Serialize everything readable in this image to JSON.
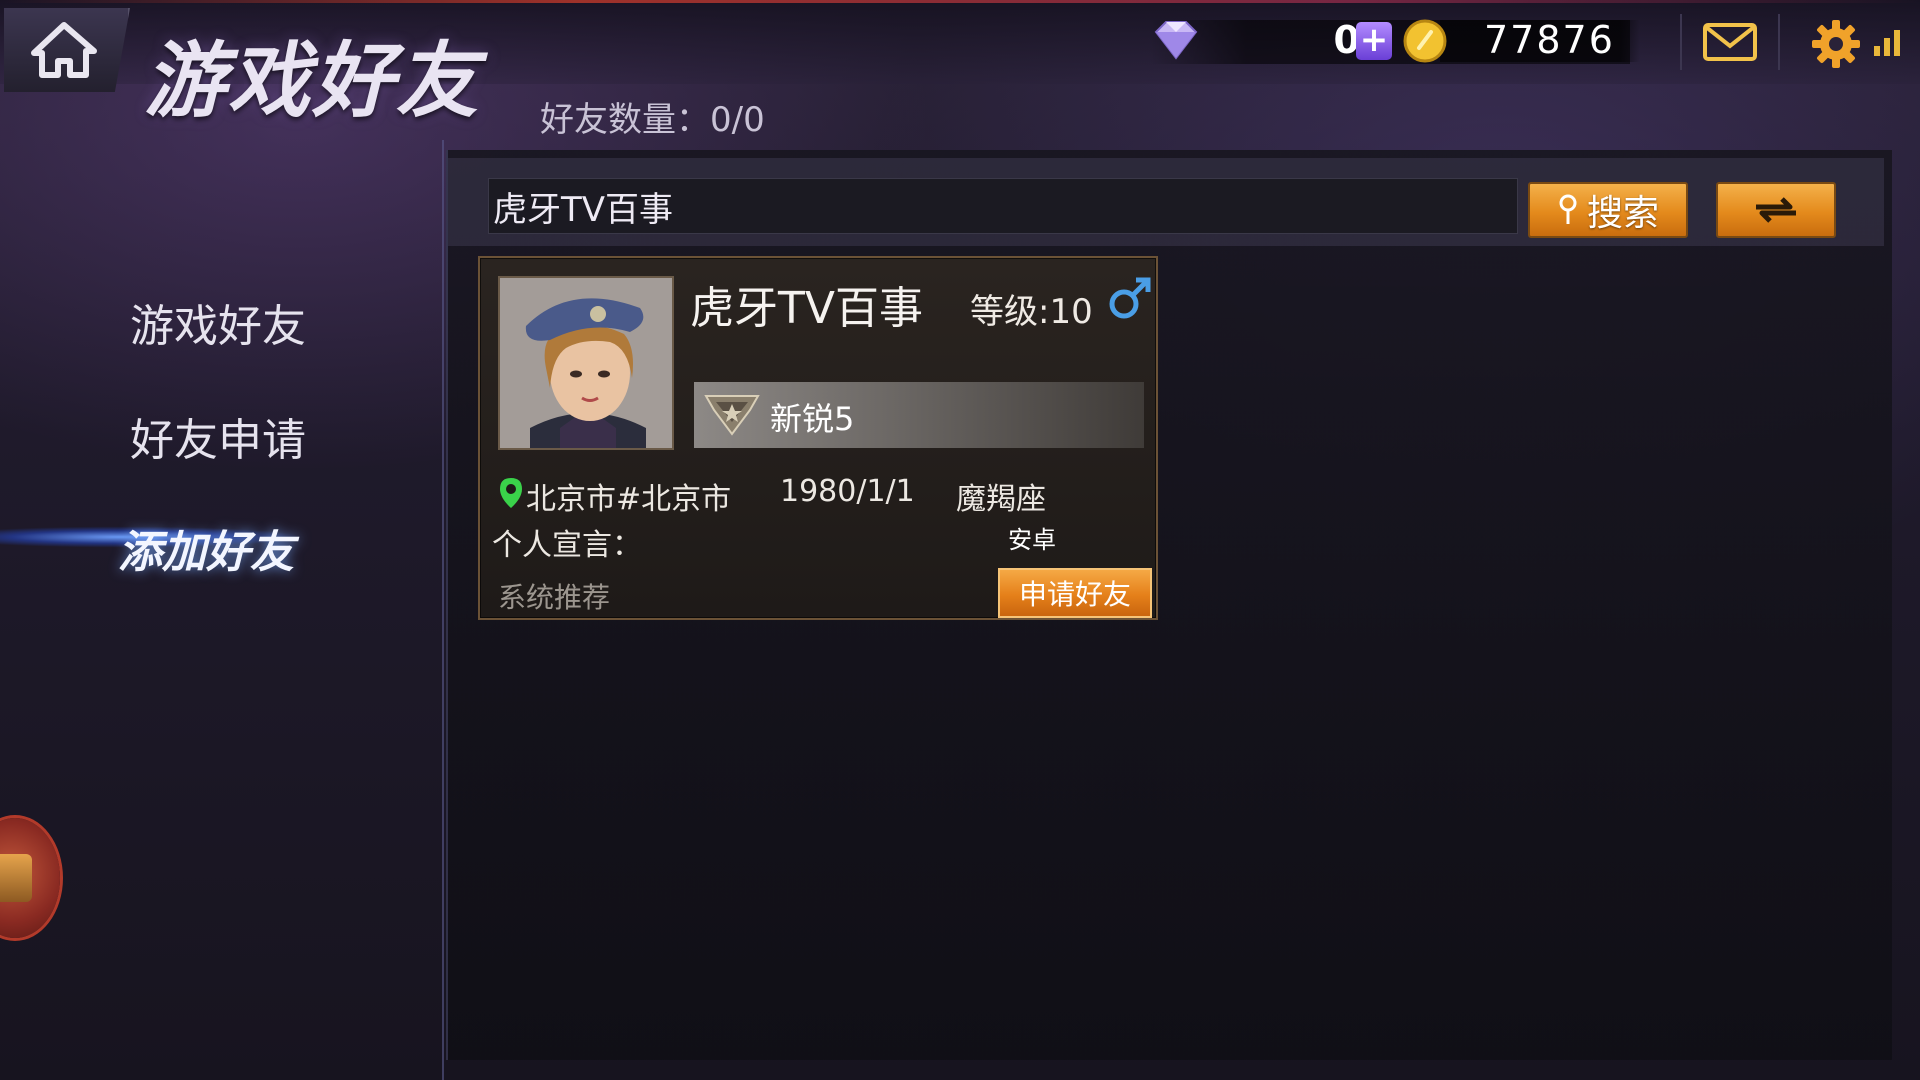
{
  "header": {
    "title": "游戏好友",
    "friend_count_label": "好友数量：0/0"
  },
  "currency": {
    "gems": "0",
    "coins": "77876"
  },
  "sidebar": {
    "items": [
      {
        "label": "游戏好友",
        "active": false
      },
      {
        "label": "好友申请",
        "active": false
      },
      {
        "label": "添加好友",
        "active": true
      }
    ]
  },
  "search": {
    "value": "虎牙TV百事",
    "placeholder": "",
    "button_label": "搜索"
  },
  "result_card": {
    "name": "虎牙TV百事",
    "level": "等级:10",
    "gender": "male",
    "rank": "新锐5",
    "location": "北京市#北京市",
    "birthday": "1980/1/1",
    "zodiac": "魔羯座",
    "motto_label": "个人宣言：",
    "platform": "安卓",
    "source": "系统推荐",
    "apply_label": "申请好友"
  },
  "colors": {
    "accent_orange": "#e48a1c",
    "gender_blue": "#4a9ee6",
    "location_green": "#3ad24a",
    "active_glow": "#6ea0ff"
  },
  "icons": [
    "home-icon",
    "diamond-icon",
    "plus-icon",
    "coin-icon",
    "mail-icon",
    "gear-icon",
    "signal-icon",
    "search-icon",
    "refresh-icon",
    "male-icon",
    "rank-badge-icon",
    "location-icon",
    "chest-icon"
  ]
}
